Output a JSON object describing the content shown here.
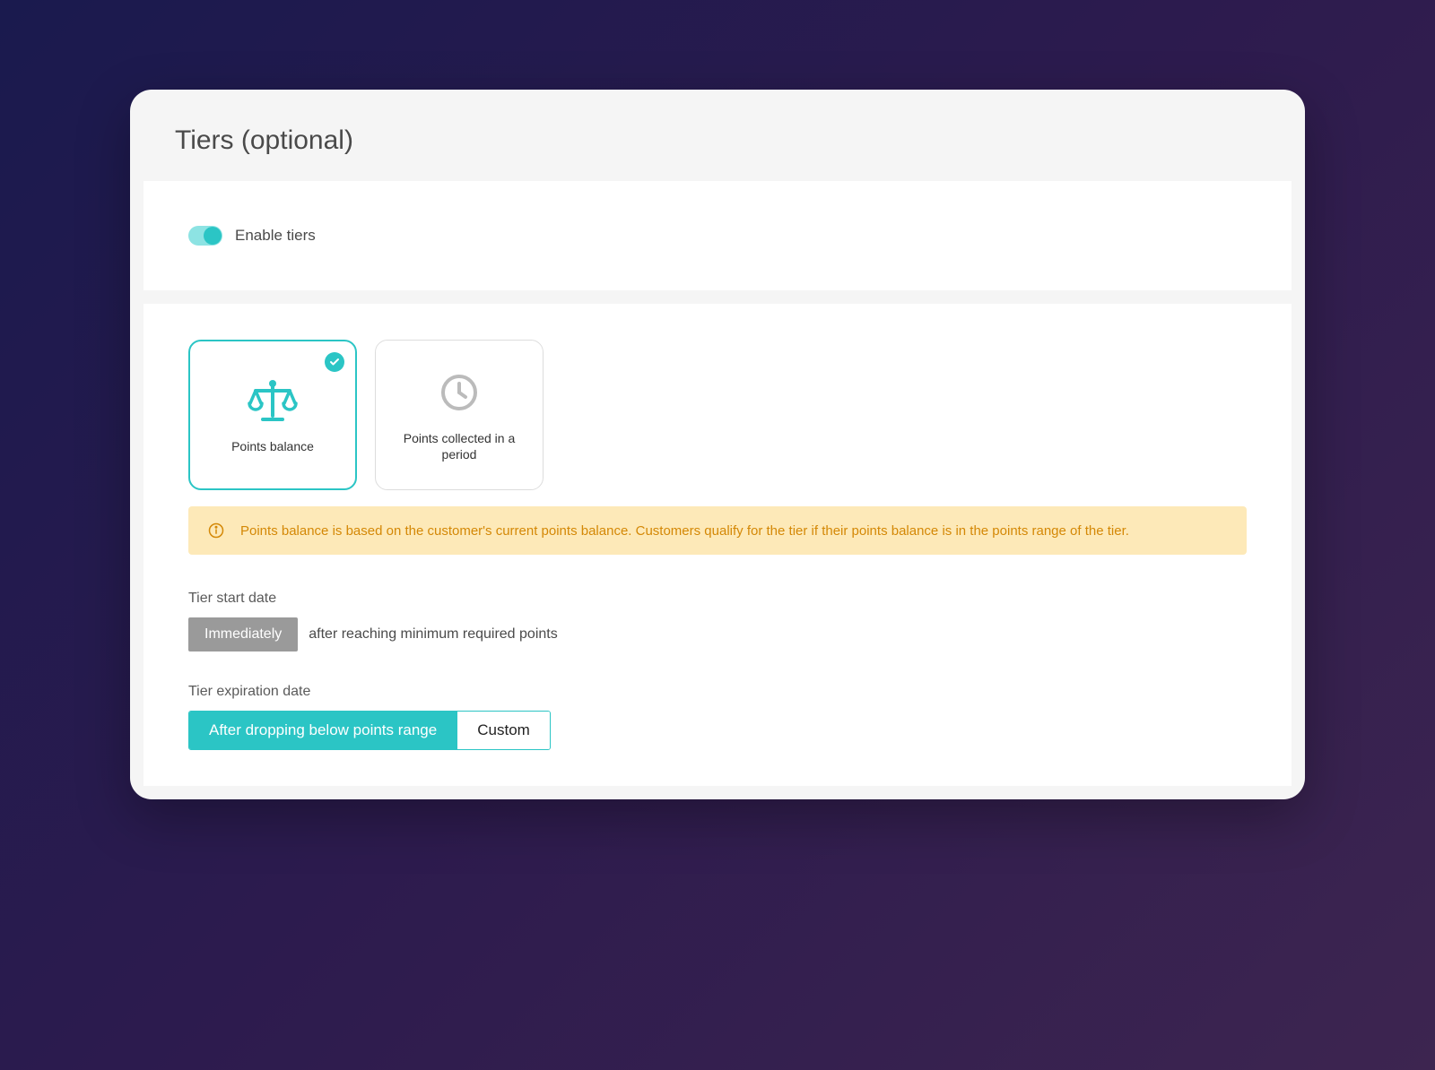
{
  "header": {
    "title": "Tiers (optional)"
  },
  "enable": {
    "label": "Enable tiers",
    "on": true
  },
  "options": {
    "points_balance": {
      "label": "Points balance",
      "selected": true
    },
    "points_period": {
      "label": "Points collected in a period",
      "selected": false
    }
  },
  "info": {
    "text": "Points balance is based on the customer's current points balance. Customers qualify for the tier if their points balance is in the points range of the tier."
  },
  "start_date": {
    "label": "Tier start date",
    "button": "Immediately",
    "suffix": "after reaching minimum required points"
  },
  "expiration": {
    "label": "Tier expiration date",
    "option_a": "After dropping below points range",
    "option_b": "Custom"
  }
}
